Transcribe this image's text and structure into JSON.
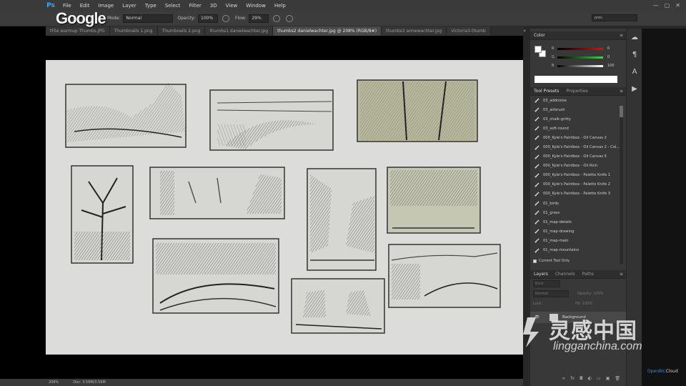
{
  "app": {
    "logo": "Ps",
    "overlay_logo": "Google"
  },
  "menu": [
    "File",
    "Edit",
    "Image",
    "Layer",
    "Type",
    "Select",
    "Filter",
    "3D",
    "View",
    "Window",
    "Help"
  ],
  "window_controls": [
    "—",
    "▢",
    "✕"
  ],
  "options": {
    "mode_label": "Mode:",
    "mode_value": "Normal",
    "opacity_label": "Opacity:",
    "opacity_value": "100%",
    "flow_label": "Flow:",
    "flow_value": "29%"
  },
  "workspace_search": "pres",
  "tabs": [
    "tFile warmup Thumbs.JPG",
    "Thumbnails 1.png",
    "Thumbnails 2.png",
    "thumbs1 danielwachter.jpg",
    "thumbs2 danielwachter.jpg @ 208% (RGB/8#)",
    "thumbs3 annewachter.jpg",
    "Victoria3-thumb"
  ],
  "active_tab_index": 4,
  "status": {
    "zoom": "208%",
    "doc": "Doc: 3.59M/3.59M"
  },
  "color_panel": {
    "title": "Color",
    "sliders": [
      {
        "letter": "R",
        "value": "0"
      },
      {
        "letter": "G",
        "value": "0"
      },
      {
        "letter": "B",
        "value": "100"
      }
    ]
  },
  "presets_panel": {
    "tab_active": "Tool Presets",
    "tab_inactive": "Properties",
    "items": [
      "03_addnoise",
      "03_airbrush",
      "03_chalk-gritty",
      "03_soft-round",
      "000_Kyle's Paintbox - Oil Canvas 2",
      "000_Kyle's Paintbox - Oil Canvas 2 - Col...",
      "000_Kyle's Paintbox - Oil Canvas 5",
      "000_Kyle's Paintbox - Oil Rich",
      "000_Kyle's Paintbox - Palette Knife 1",
      "000_Kyle's Paintbox - Palette Knife 2",
      "000_Kyle's Paintbox - Palette Knife 3",
      "01_birds",
      "01_grass",
      "01_map-details",
      "01_map-drawing",
      "01_map-main",
      "01_map-mountains"
    ],
    "current_tool_only": "Current Tool Only"
  },
  "layers_panel": {
    "tab_active": "Layers",
    "tab_inactive_1": "Channels",
    "tab_inactive_2": "Paths",
    "kind": "Kind",
    "blend": "Normal",
    "opacity": "Opacity: 100%",
    "lock": "Lock:",
    "fill": "Fill: 100%",
    "layer_name": "Background"
  },
  "watermark": {
    "cn": "灵感中国",
    "en": "lingganchina.com"
  },
  "corner_brand": {
    "part1": "OpenBir",
    "part2": ".Cloud"
  },
  "colors": {
    "accent_blue": "#31a8ff",
    "panel": "#383838",
    "paper": "#dcdcda"
  }
}
